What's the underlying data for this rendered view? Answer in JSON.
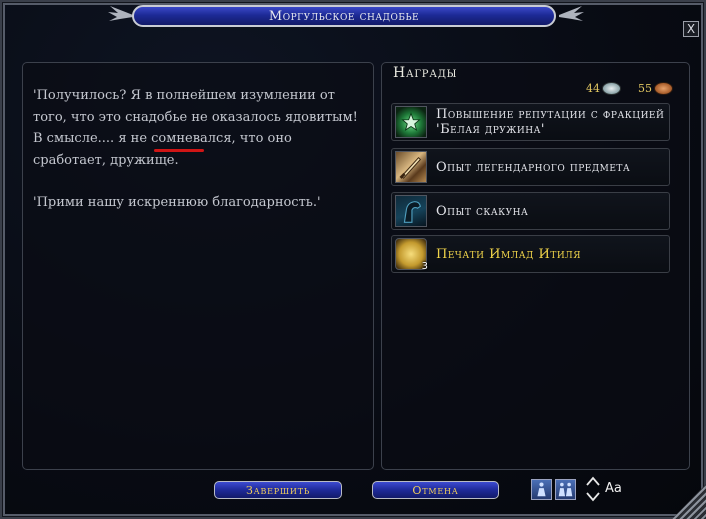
{
  "window": {
    "title": "Моргульское снадобье",
    "close_label": "X"
  },
  "dialog": {
    "paragraph_1": "'Получилось? Я в полнейшем изумлении от того, что это снадобье не оказалось ядовитым! В смысле.... я не сомневался, что оно сработает, дружище.",
    "paragraph_2": "'Прими нашу искреннюю благодарность.'"
  },
  "rewards": {
    "heading": "Награды",
    "money": {
      "silver": "44",
      "copper": "55"
    },
    "items": [
      {
        "label": "Повышение репутации с фракцией 'Белая дружина'",
        "icon": "faction-reputation-icon"
      },
      {
        "label": "Опыт легендарного предмета",
        "icon": "legendary-item-icon"
      },
      {
        "label": "Опыт скакуна",
        "icon": "mount-icon"
      },
      {
        "label": "Печати Имлад Итиля",
        "icon": "seal-coin-icon",
        "count": "3"
      }
    ]
  },
  "buttons": {
    "finish": "Завершить",
    "cancel": "Отмена"
  },
  "font_control": {
    "label": "Aa"
  },
  "colors": {
    "title_bar_blue": "#1d2a96",
    "button_text_gold": "#f2d05a",
    "highlight_yellow": "#f1d54a",
    "underline_red": "#d01515"
  }
}
